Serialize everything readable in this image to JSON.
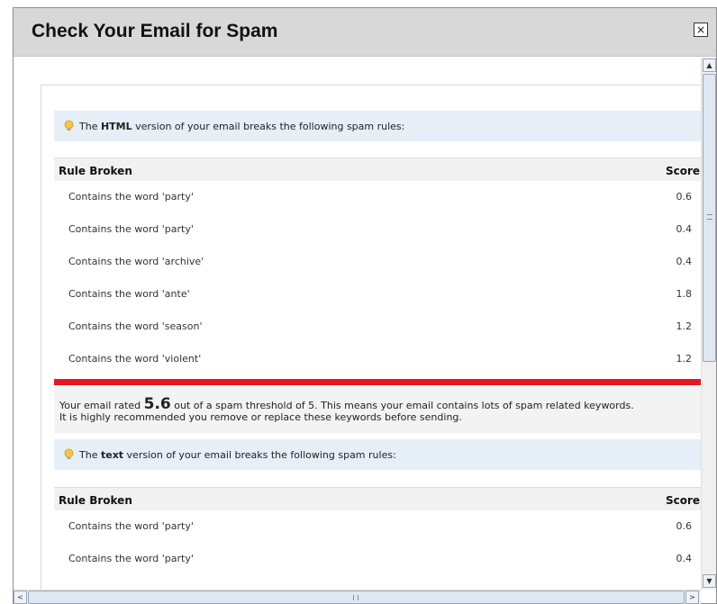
{
  "dialog": {
    "title": "Check Your Email for Spam",
    "close_label": "×"
  },
  "html_section": {
    "notice_prefix": "The ",
    "notice_bold": "HTML",
    "notice_suffix": " version of your email breaks the following spam rules:",
    "col_rule": "Rule Broken",
    "col_score": "Score",
    "rows": [
      {
        "rule": "Contains the word 'party'",
        "score": "0.6"
      },
      {
        "rule": "Contains the word 'party'",
        "score": "0.4"
      },
      {
        "rule": "Contains the word 'archive'",
        "score": "0.4"
      },
      {
        "rule": "Contains the word 'ante'",
        "score": "1.8"
      },
      {
        "rule": "Contains the word 'season'",
        "score": "1.2"
      },
      {
        "rule": "Contains the word 'violent'",
        "score": "1.2"
      }
    ],
    "rating_prefix": "Your email rated ",
    "rating_value": "5.6",
    "rating_suffix": " out of a spam threshold of 5. This means your email contains lots of spam related keywords.",
    "rating_line2": "It is highly recommended you remove or replace these keywords before sending."
  },
  "text_section": {
    "notice_prefix": "The ",
    "notice_bold": "text",
    "notice_suffix": " version of your email breaks the following spam rules:",
    "col_rule": "Rule Broken",
    "col_score": "Score",
    "rows": [
      {
        "rule": "Contains the word 'party'",
        "score": "0.6"
      },
      {
        "rule": "Contains the word 'party'",
        "score": "0.4"
      }
    ]
  },
  "scrollbars": {
    "up": "▲",
    "down": "▼",
    "left": "<",
    "right": ">"
  },
  "colors": {
    "spam_bar": "#e8171f",
    "notice_bg": "#e6eef8"
  }
}
